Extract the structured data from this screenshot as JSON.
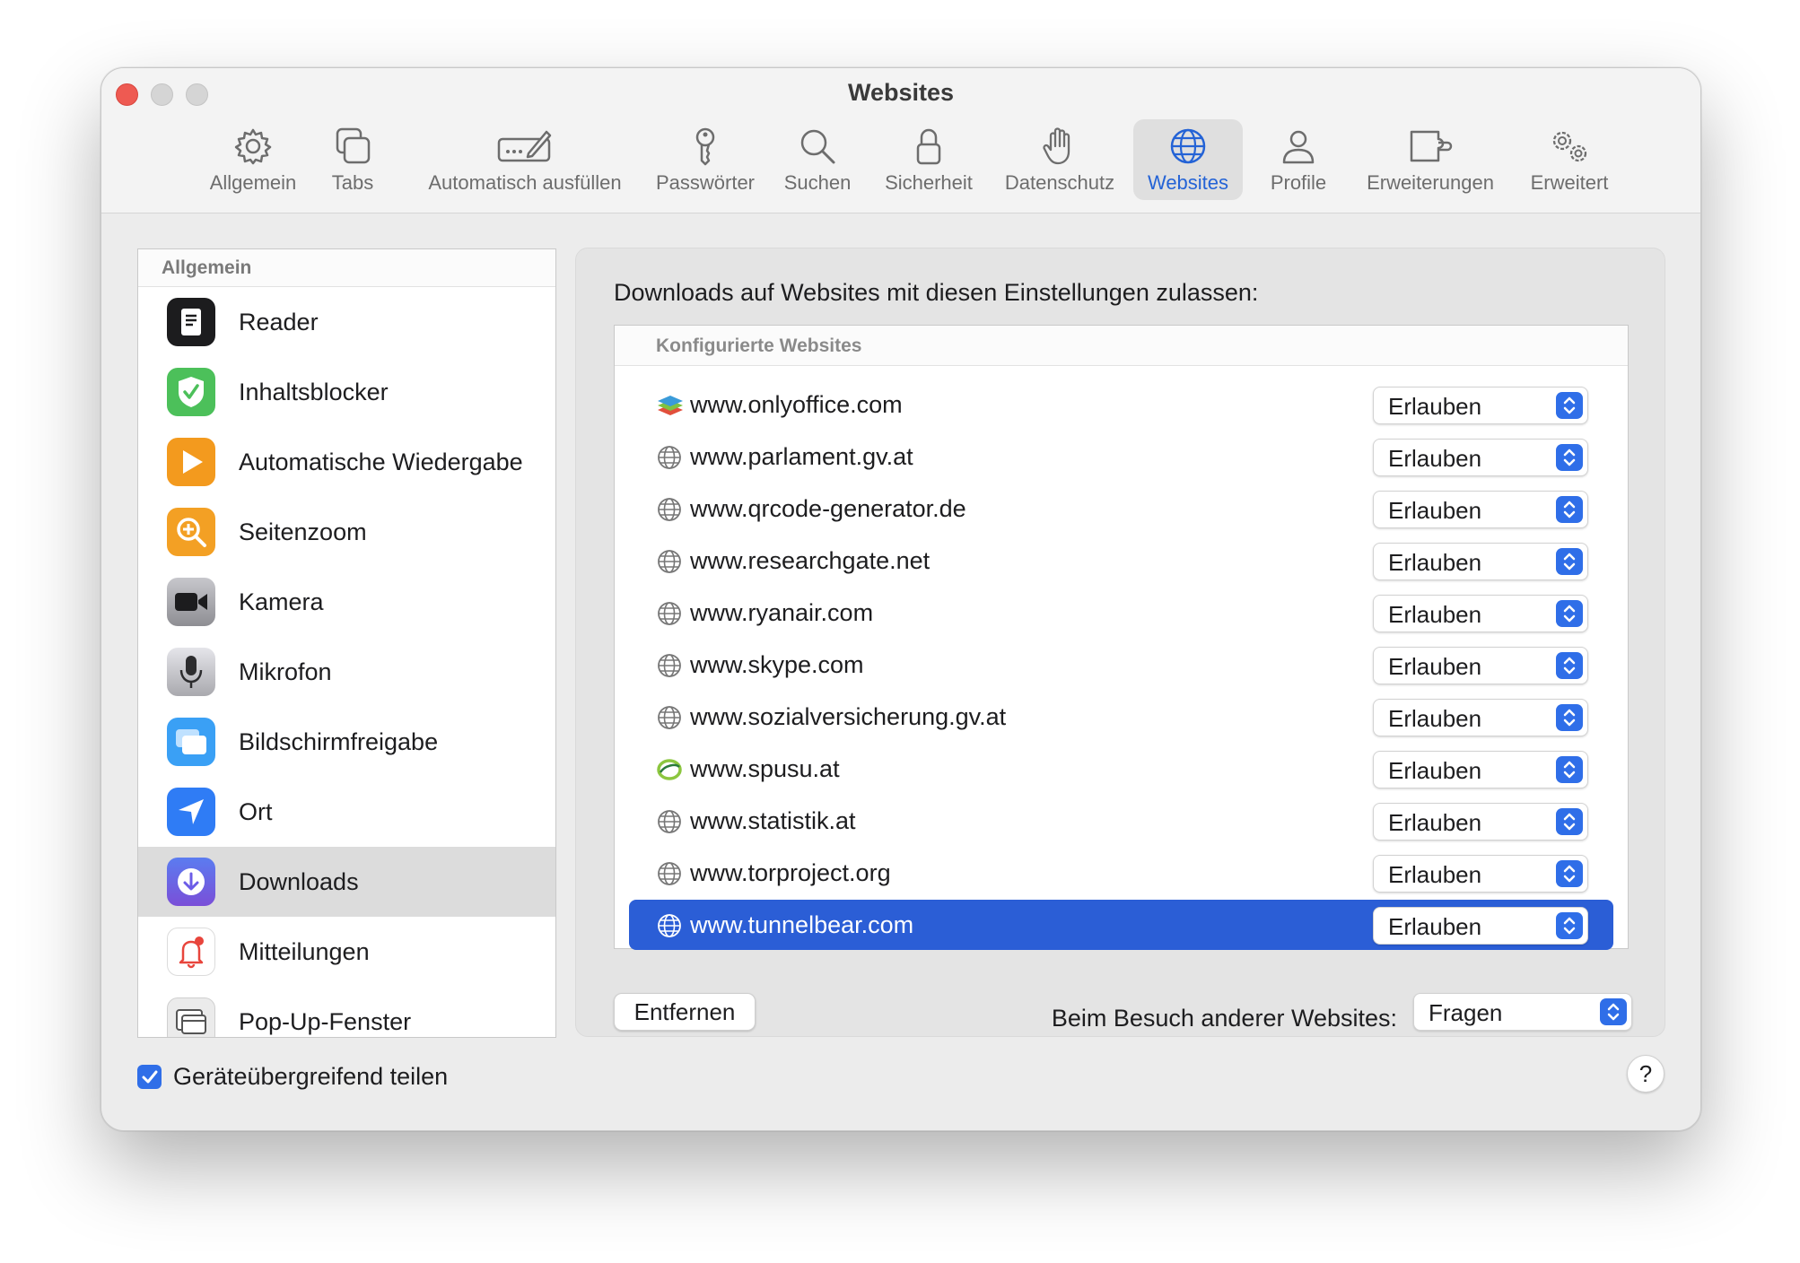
{
  "window": {
    "title": "Websites"
  },
  "toolbar": {
    "items": [
      {
        "label": "Allgemein",
        "icon": "gear-icon"
      },
      {
        "label": "Tabs",
        "icon": "tabs-icon"
      },
      {
        "label": "Automatisch ausfüllen",
        "icon": "autofill-icon"
      },
      {
        "label": "Passwörter",
        "icon": "key-icon"
      },
      {
        "label": "Suchen",
        "icon": "magnifier-icon"
      },
      {
        "label": "Sicherheit",
        "icon": "lock-icon"
      },
      {
        "label": "Datenschutz",
        "icon": "hand-icon"
      },
      {
        "label": "Websites",
        "icon": "globe-icon",
        "active": true
      },
      {
        "label": "Profile",
        "icon": "person-icon"
      },
      {
        "label": "Erweiterungen",
        "icon": "puzzle-icon"
      },
      {
        "label": "Erweitert",
        "icon": "gears-icon"
      }
    ]
  },
  "sidebar": {
    "header": "Allgemein",
    "items": [
      {
        "label": "Reader",
        "icon": "reader-icon",
        "color": "#1c1c1e"
      },
      {
        "label": "Inhaltsblocker",
        "icon": "shield-check-icon",
        "color": "#4cc05a"
      },
      {
        "label": "Automatische Wiedergabe",
        "icon": "play-icon",
        "color": "#f39a1e"
      },
      {
        "label": "Seitenzoom",
        "icon": "zoom-icon",
        "color": "#f3a024"
      },
      {
        "label": "Kamera",
        "icon": "camera-icon",
        "color": "#8e8e93"
      },
      {
        "label": "Mikrofon",
        "icon": "microphone-icon",
        "color": "#a9a9ae"
      },
      {
        "label": "Bildschirmfreigabe",
        "icon": "screen-share-icon",
        "color": "#3aa0f5"
      },
      {
        "label": "Ort",
        "icon": "location-arrow-icon",
        "color": "#2f7cf5"
      },
      {
        "label": "Downloads",
        "icon": "download-icon",
        "color": "#6c5ce7",
        "selected": true
      },
      {
        "label": "Mitteilungen",
        "icon": "bell-icon",
        "color": "#ffffff"
      },
      {
        "label": "Pop-Up-Fenster",
        "icon": "popup-window-icon",
        "color": "#e5e5e5"
      }
    ]
  },
  "main": {
    "heading": "Downloads auf Websites mit diesen Einstellungen zulassen:",
    "table_header": "Konfigurierte Websites",
    "rows": [
      {
        "site": "www.onlyoffice.com",
        "value": "Erlauben",
        "icon": "onlyoffice-icon"
      },
      {
        "site": "www.parlament.gv.at",
        "value": "Erlauben",
        "icon": "globe-icon"
      },
      {
        "site": "www.qrcode-generator.de",
        "value": "Erlauben",
        "icon": "globe-icon"
      },
      {
        "site": "www.researchgate.net",
        "value": "Erlauben",
        "icon": "globe-icon"
      },
      {
        "site": "www.ryanair.com",
        "value": "Erlauben",
        "icon": "globe-icon"
      },
      {
        "site": "www.skype.com",
        "value": "Erlauben",
        "icon": "globe-icon"
      },
      {
        "site": "www.sozialversicherung.gv.at",
        "value": "Erlauben",
        "icon": "globe-icon"
      },
      {
        "site": "www.spusu.at",
        "value": "Erlauben",
        "icon": "spusu-icon"
      },
      {
        "site": "www.statistik.at",
        "value": "Erlauben",
        "icon": "globe-icon"
      },
      {
        "site": "www.torproject.org",
        "value": "Erlauben",
        "icon": "globe-icon"
      },
      {
        "site": "www.tunnelbear.com",
        "value": "Erlauben",
        "icon": "globe-icon",
        "selected": true
      }
    ],
    "remove_button": "Entfernen",
    "other_sites_label": "Beim Besuch anderer Websites:",
    "other_sites_value": "Fragen"
  },
  "footer": {
    "sync_checkbox_label": "Geräteübergreifend teilen",
    "sync_checked": true,
    "help_label": "?"
  },
  "colors": {
    "accent": "#2f6ee8",
    "selection": "#2b5ed6",
    "close_button": "#ee5a52"
  }
}
